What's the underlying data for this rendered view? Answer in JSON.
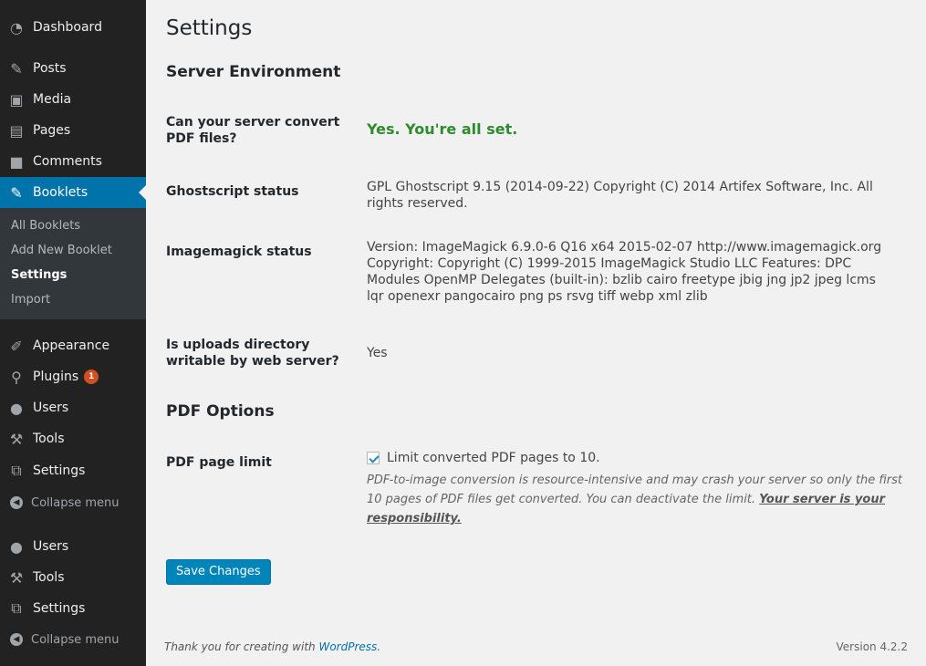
{
  "sidebar": {
    "items": [
      {
        "label": "Dashboard",
        "icon": "dashboard-icon",
        "glyph": "◔"
      },
      {
        "label": "Posts",
        "icon": "pin-icon",
        "glyph": "✎"
      },
      {
        "label": "Media",
        "icon": "media-icon",
        "glyph": "▣"
      },
      {
        "label": "Pages",
        "icon": "pages-icon",
        "glyph": "▤"
      },
      {
        "label": "Comments",
        "icon": "comment-icon",
        "glyph": "■"
      },
      {
        "label": "Booklets",
        "icon": "pin-icon",
        "glyph": "✎",
        "current": true
      }
    ],
    "submenu": [
      {
        "label": "All Booklets"
      },
      {
        "label": "Add New Booklet"
      },
      {
        "label": "Settings",
        "active": true
      },
      {
        "label": "Import"
      }
    ],
    "items2": [
      {
        "label": "Appearance",
        "icon": "brush-icon",
        "glyph": "✐"
      },
      {
        "label": "Plugins",
        "icon": "plugin-icon",
        "glyph": "⚲",
        "badge": "1"
      },
      {
        "label": "Users",
        "icon": "user-icon",
        "glyph": "●"
      },
      {
        "label": "Tools",
        "icon": "wrench-icon",
        "glyph": "⚒"
      },
      {
        "label": "Settings",
        "icon": "settings-icon",
        "glyph": "⧉"
      }
    ],
    "collapse1": "Collapse menu",
    "items3": [
      {
        "label": "Users",
        "icon": "user-icon",
        "glyph": "●"
      },
      {
        "label": "Tools",
        "icon": "wrench-icon",
        "glyph": "⚒"
      },
      {
        "label": "Settings",
        "icon": "settings-icon",
        "glyph": "⧉"
      }
    ],
    "collapse2": "Collapse menu",
    "colors": {
      "background": "#222222",
      "current": "#0073aa",
      "submenu": "#32373c"
    }
  },
  "main": {
    "title": "Settings",
    "server_section": "Server Environment",
    "rows": {
      "convert": {
        "label": "Can your server convert PDF files?",
        "value": "Yes. You're all set."
      },
      "ghostscript": {
        "label": "Ghostscript status",
        "value": "GPL Ghostscript 9.15 (2014-09-22) Copyright (C) 2014 Artifex Software, Inc. All rights reserved."
      },
      "imagemagick": {
        "label": "Imagemagick status",
        "value": "Version: ImageMagick 6.9.0-6 Q16 x64 2015-02-07 http://www.imagemagick.org Copyright: Copyright (C) 1999-2015 ImageMagick Studio LLC Features: DPC Modules OpenMP Delegates (built-in): bzlib cairo freetype jbig jng jp2 jpeg lcms lqr openexr pangocairo png ps rsvg tiff webp xml zlib"
      },
      "uploads": {
        "label": "Is uploads directory writable by web server?",
        "value": "Yes"
      }
    },
    "pdf_section": "PDF Options",
    "pdf_limit": {
      "label": "PDF page limit",
      "checkbox_label": "Limit converted PDF pages to 10.",
      "checked": true,
      "description": "PDF-to-image conversion is resource-intensive and may crash your server so only the first 10 pages of PDF files get converted. You can deactivate the limit.",
      "link": "Your server is your responsibility."
    },
    "save_label": "Save Changes",
    "ok_color": "#2e8b2e"
  },
  "footer": {
    "thanks": "Thank you for creating with",
    "wp_link": "WordPress",
    "period": ".",
    "version": "Version 4.2.2"
  }
}
